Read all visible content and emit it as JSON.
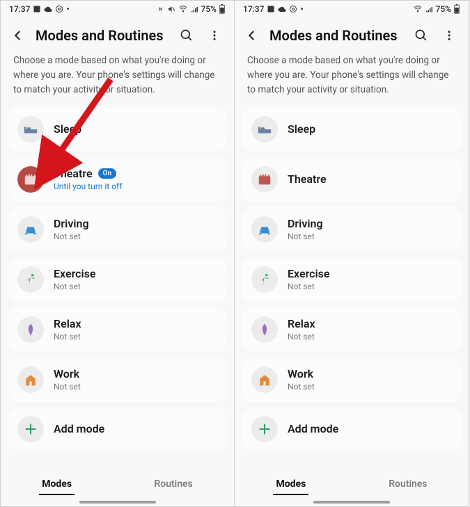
{
  "status": {
    "time": "17:37",
    "battery": "75%"
  },
  "header": {
    "title": "Modes and Routines"
  },
  "description": "Choose a mode based on what you're doing or where you are. Your phone's settings will change to match your activity or situation.",
  "modes_left": [
    {
      "label": "Sleep",
      "sub": "",
      "icon": "sleep"
    },
    {
      "label": "Theatre",
      "sub": "Until you turn it off",
      "icon": "theatre",
      "badge": "On",
      "active": true
    },
    {
      "label": "Driving",
      "sub": "Not set",
      "icon": "driving"
    },
    {
      "label": "Exercise",
      "sub": "Not set",
      "icon": "exercise"
    },
    {
      "label": "Relax",
      "sub": "Not set",
      "icon": "relax"
    },
    {
      "label": "Work",
      "sub": "Not set",
      "icon": "work"
    },
    {
      "label": "Add mode",
      "sub": "",
      "icon": "add"
    }
  ],
  "modes_right": [
    {
      "label": "Sleep",
      "sub": "",
      "icon": "sleep"
    },
    {
      "label": "Theatre",
      "sub": "",
      "icon": "theatre"
    },
    {
      "label": "Driving",
      "sub": "Not set",
      "icon": "driving"
    },
    {
      "label": "Exercise",
      "sub": "Not set",
      "icon": "exercise"
    },
    {
      "label": "Relax",
      "sub": "Not set",
      "icon": "relax"
    },
    {
      "label": "Work",
      "sub": "Not set",
      "icon": "work"
    },
    {
      "label": "Add mode",
      "sub": "",
      "icon": "add"
    }
  ],
  "tabs": {
    "modes": "Modes",
    "routines": "Routines"
  }
}
